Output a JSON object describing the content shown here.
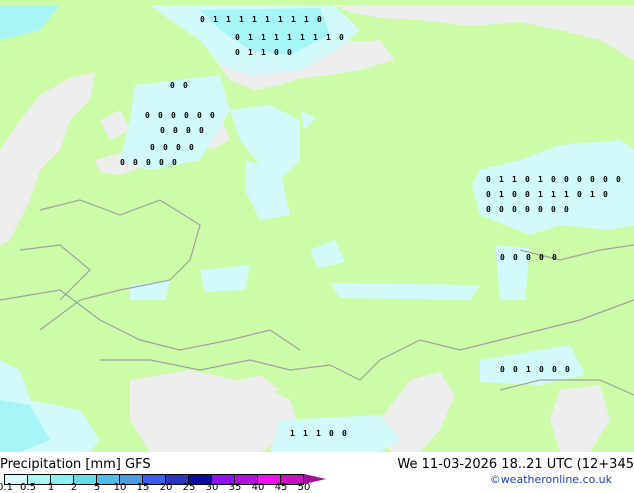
{
  "title": "Precipitation [mm]",
  "model": "GFS",
  "datetime": "We 11-03-2026 18..21 UTC (12+345",
  "credit": "©weatheronline.co.uk",
  "colors": {
    "land": "#ccfca8",
    "sea": "#eeeeee",
    "border": "#a0a0a0",
    "precip_light": "#d2fafa",
    "precip_mid": "#a6f6f8"
  },
  "scale": {
    "labels": [
      "0.1",
      "0.5",
      "1",
      "2",
      "5",
      "10",
      "15",
      "20",
      "25",
      "30",
      "35",
      "40",
      "45",
      "50"
    ],
    "colors": [
      "#d8fcfc",
      "#a8f8f8",
      "#8cf0f0",
      "#64dcec",
      "#50bce8",
      "#4c9ce4",
      "#3c5cf0",
      "#2c34c0",
      "#0c0c9c",
      "#9010f0",
      "#b010e0",
      "#f010f0",
      "#c810c0"
    ]
  },
  "markers": [
    "0 1 1 1 1 1 1 1 1 0",
    "0 1 1 1 1 1 1 1 0",
    "0 1 1 0 0",
    "0 0",
    "0 0 0 0 0 0",
    "0 0 0 0",
    "0 0 0 0",
    "0 0 0 0 0",
    "0 1 1 0 1 0 0 0 0 0 0",
    "0 1 0 0 1 1 1 0 1 0",
    "0 0 0 0 0 0 0",
    "0 0 0 0 0",
    "0 0 1 0 0 0",
    "1 1 1 0 0"
  ]
}
